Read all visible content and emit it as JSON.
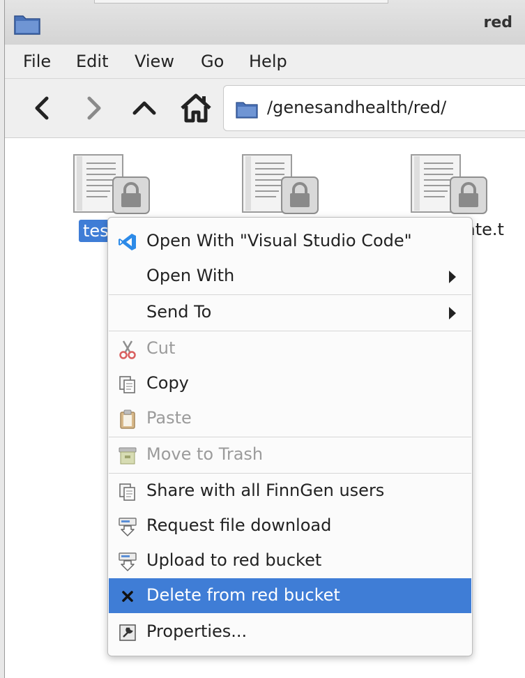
{
  "window": {
    "title": "red"
  },
  "menubar": {
    "items": [
      "File",
      "Edit",
      "View",
      "Go",
      "Help"
    ]
  },
  "toolbar": {
    "back_icon": "chevron-left-icon",
    "forward_icon": "chevron-right-icon",
    "up_icon": "chevron-up-icon",
    "home_icon": "home-icon",
    "location": "/genesandhealth/red/"
  },
  "files": [
    {
      "label": "tes",
      "selected": true,
      "icon": "locked-text-file-icon"
    },
    {
      "label": "",
      "selected": false,
      "icon": "locked-text-file-icon"
    },
    {
      "label": "ate.t",
      "selected": false,
      "icon": "locked-text-file-icon"
    }
  ],
  "context_menu": {
    "items": [
      {
        "label": "Open With \"Visual Studio Code\"",
        "icon": "vscode-icon",
        "enabled": true
      },
      {
        "label": "Open With",
        "submenu": true,
        "enabled": true
      },
      {
        "label": "Send To",
        "submenu": true,
        "enabled": true
      },
      {
        "label": "Cut",
        "icon": "scissors-icon",
        "enabled": false
      },
      {
        "label": "Copy",
        "icon": "copy-icon",
        "enabled": true
      },
      {
        "label": "Paste",
        "icon": "clipboard-icon",
        "enabled": false
      },
      {
        "label": "Move to Trash",
        "icon": "trash-icon",
        "enabled": false
      },
      {
        "label": "Share with all FinnGen users",
        "icon": "copy-icon",
        "enabled": true
      },
      {
        "label": "Request file download",
        "icon": "download-icon",
        "enabled": true
      },
      {
        "label": "Upload to red bucket",
        "icon": "upload-icon",
        "enabled": true
      },
      {
        "label": "Delete from red bucket",
        "icon": "x-icon",
        "enabled": true,
        "highlighted": true
      },
      {
        "label": "Properties...",
        "icon": "properties-icon",
        "enabled": true
      }
    ]
  },
  "colors": {
    "selection": "#3f7dd6",
    "folder": "#4a72b8"
  }
}
